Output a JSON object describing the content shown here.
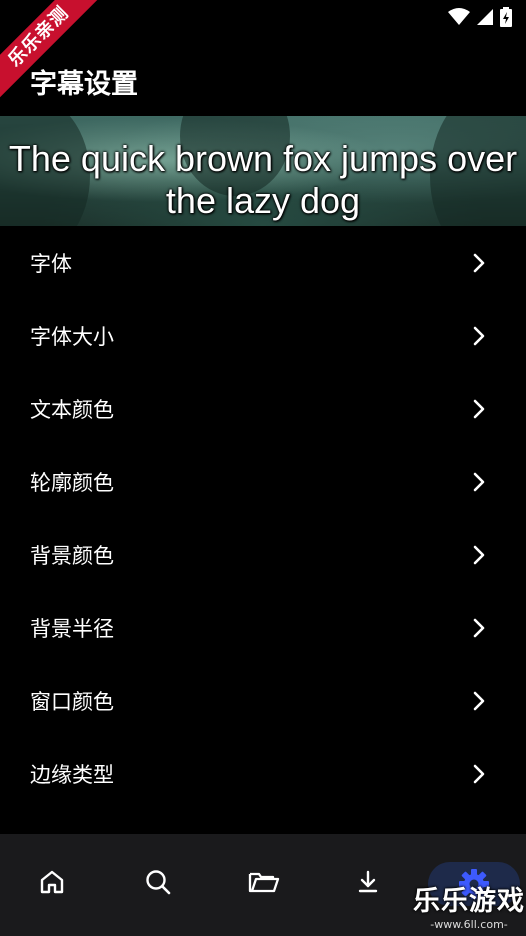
{
  "ribbon": {
    "text": "乐乐亲测"
  },
  "app_bar": {
    "title": "字幕设置"
  },
  "preview": {
    "sample_text": "The quick brown fox jumps over the lazy dog"
  },
  "menu": {
    "items": [
      {
        "label": "字体"
      },
      {
        "label": "字体大小"
      },
      {
        "label": "文本颜色"
      },
      {
        "label": "轮廓颜色"
      },
      {
        "label": "背景颜色"
      },
      {
        "label": "背景半径"
      },
      {
        "label": "窗口颜色"
      },
      {
        "label": "边缘类型"
      }
    ]
  },
  "bottom_nav": {
    "items": [
      {
        "icon": "home-icon"
      },
      {
        "icon": "search-icon"
      },
      {
        "icon": "folder-icon"
      },
      {
        "icon": "download-icon"
      },
      {
        "icon": "settings-icon",
        "active": true
      }
    ],
    "active_color": "#3d5afe"
  },
  "watermark": {
    "title": "乐乐游戏",
    "url": "-www.6ll.com-"
  }
}
